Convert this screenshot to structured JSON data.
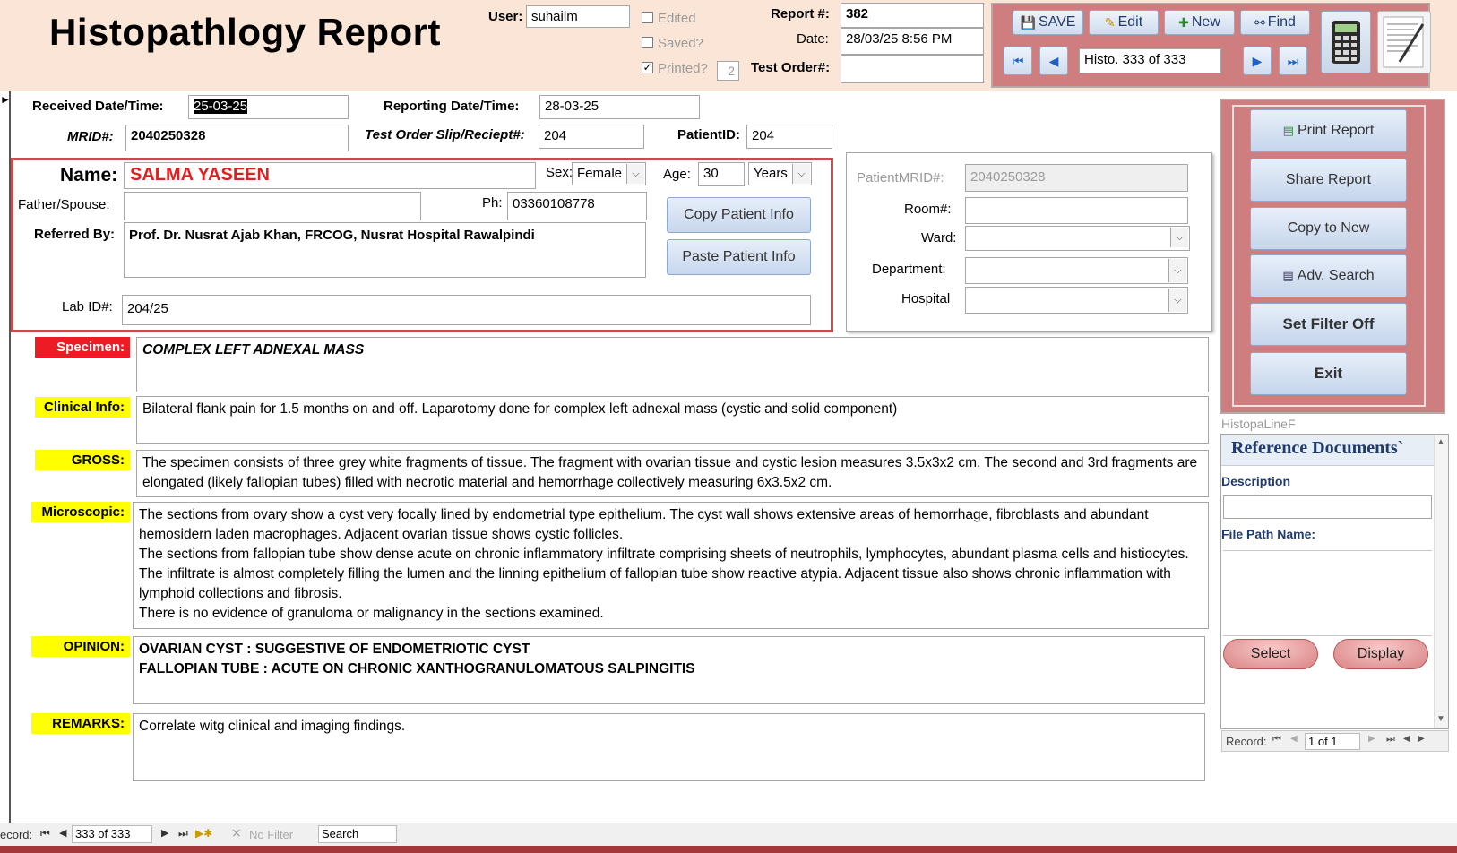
{
  "header": {
    "title": "Histopathlogy Report",
    "user_label": "User:",
    "user_value": "suhailm",
    "edited_label": "Edited",
    "saved_label": "Saved?",
    "printed_label": "Printed?",
    "printed_count": "2",
    "printed_check": "✓",
    "report_no_label": "Report #:",
    "report_no_value": "382",
    "date_label": "Date:",
    "date_value": "28/03/25 8:56 PM",
    "test_order_label": "Test Order#:",
    "test_order_value": ""
  },
  "toolbar": {
    "save_label": "SAVE",
    "edit_label": "Edit",
    "new_label": "New",
    "find_label": "Find",
    "record_nav_value": "Histo. 333 of 333",
    "save_icon": "floppy-icon",
    "edit_icon": "pencil-icon",
    "new_icon": "new-record-icon",
    "find_icon": "binoculars-icon",
    "calculator_icon": "calculator-icon",
    "notepad_icon": "notepad-icon"
  },
  "dates": {
    "received_label": "Received Date/Time:",
    "received_value": "25-03-25",
    "reporting_label": "Reporting Date/Time:",
    "reporting_value": "28-03-25",
    "mrid_label": "MRID#:",
    "mrid_value": "2040250328",
    "slip_label": "Test Order Slip/Reciept#:",
    "slip_value": "204",
    "patientid_label": "PatientID:",
    "patientid_value": "204"
  },
  "patient": {
    "name_label": "Name:",
    "name_value": "SALMA YASEEN",
    "sex_label": "Sex:",
    "sex_value": "Female",
    "age_label": "Age:",
    "age_value": "30",
    "age_unit": "Years",
    "father_label": "Father/Spouse:",
    "father_value": "",
    "ph_label": "Ph:",
    "ph_value": "03360108778",
    "referred_label": "Referred By:",
    "referred_value": "Prof. Dr. Nusrat Ajab Khan, FRCOG, Nusrat Hospital Rawalpindi",
    "labid_label": "Lab ID#:",
    "labid_value": "204/25",
    "copy_btn": "Copy Patient Info",
    "paste_btn": "Paste Patient Info"
  },
  "hospital": {
    "patientmrid_label": "PatientMRID#:",
    "patientmrid_value": "2040250328",
    "room_label": "Room#:",
    "room_value": "",
    "ward_label": "Ward:",
    "ward_value": "",
    "department_label": "Department:",
    "department_value": "",
    "hospital_label": "Hospital",
    "hospital_value": ""
  },
  "actions": {
    "print": "Print Report",
    "share": "Share Report",
    "copy_new": "Copy to New",
    "adv_search": "Adv. Search",
    "filter_off": "Set Filter Off",
    "exit": "Exit",
    "print_icon": "printer-icon",
    "adv_search_icon": "form-icon"
  },
  "sections": {
    "specimen_label": "Specimen:",
    "specimen_value": "COMPLEX LEFT ADNEXAL MASS",
    "clinical_label": "Clinical Info:",
    "clinical_value": "Bilateral flank pain for 1.5 months on and off. Laparotomy done for complex left adnexal mass (cystic and solid component)",
    "gross_label": "GROSS:",
    "gross_value": "The specimen consists of  three grey white fragments of tissue. The fragment with ovarian tissue and cystic lesion measures 3.5x3x2 cm. The second and 3rd fragments are elongated (likely fallopian tubes) filled with necrotic material  and hemorrhage collectively measuring 6x3.5x2 cm.",
    "micro_label": "Microscopic:",
    "micro_p1": "The sections from ovary show a cyst very focally lined by endometrial type epithelium. The cyst wall shows extensive areas of hemorrhage, fibroblasts  and abundant hemosidern laden macrophages. Adjacent ovarian tissue shows cystic follicles.",
    "micro_p2": "The sections from fallopian tube show dense acute on chronic inflammatory infiltrate comprising sheets of neutrophils, lymphocytes, abundant plasma cells and histiocytes. The infiltrate is almost completely filling the lumen and the linning epithelium of fallopian tube show reactive atypia. Adjacent tissue also shows chronic inflammation with lymphoid collections and fibrosis.",
    "micro_p3": "There is no evidence of granuloma or malignancy in the sections examined.",
    "opinion_label": "OPINION:",
    "opinion_l1": "OVARIAN CYST : SUGGESTIVE OF ENDOMETRIOTIC CYST",
    "opinion_l2": "FALLOPIAN TUBE : ACUTE ON CHRONIC XANTHOGRANULOMATOUS SALPINGITIS",
    "remarks_label": "REMARKS:",
    "remarks_value": "Correlate witg clinical and imaging findings."
  },
  "subform": {
    "name": "HistopaLineF",
    "title": "Reference Documents`",
    "description_label": "Description",
    "description_value": "",
    "filepath_label": "File Path  Name:",
    "select_btn": "Select",
    "display_btn": "Display",
    "record_label": "Record:",
    "record_value": "1 of 1"
  },
  "recordbar": {
    "record_label": "ecord:",
    "record_value": "333 of 333",
    "filter_label": "No Filter",
    "search_label": "Search"
  },
  "colors": {
    "header_bg": "#fbe5d6",
    "panel_bg": "#ce7e7e",
    "accent_red": "#c0504d",
    "label_yellow": "#ffff00",
    "label_red": "#ed1c24",
    "name_red": "#e02020"
  }
}
